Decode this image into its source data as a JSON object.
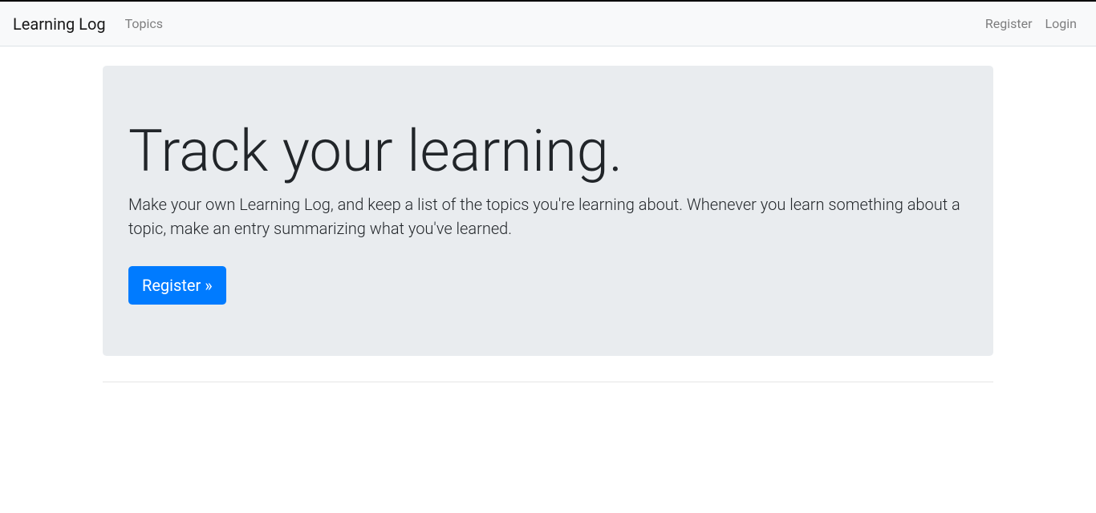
{
  "navbar": {
    "brand": "Learning Log",
    "left_links": [
      {
        "label": "Topics"
      }
    ],
    "right_links": [
      {
        "label": "Register"
      },
      {
        "label": "Login"
      }
    ]
  },
  "jumbotron": {
    "heading": "Track your learning.",
    "lead": "Make your own Learning Log, and keep a list of the topics you're learning about. Whenever you learn something about a topic, make an entry summarizing what you've learned.",
    "cta_label": "Register »"
  }
}
